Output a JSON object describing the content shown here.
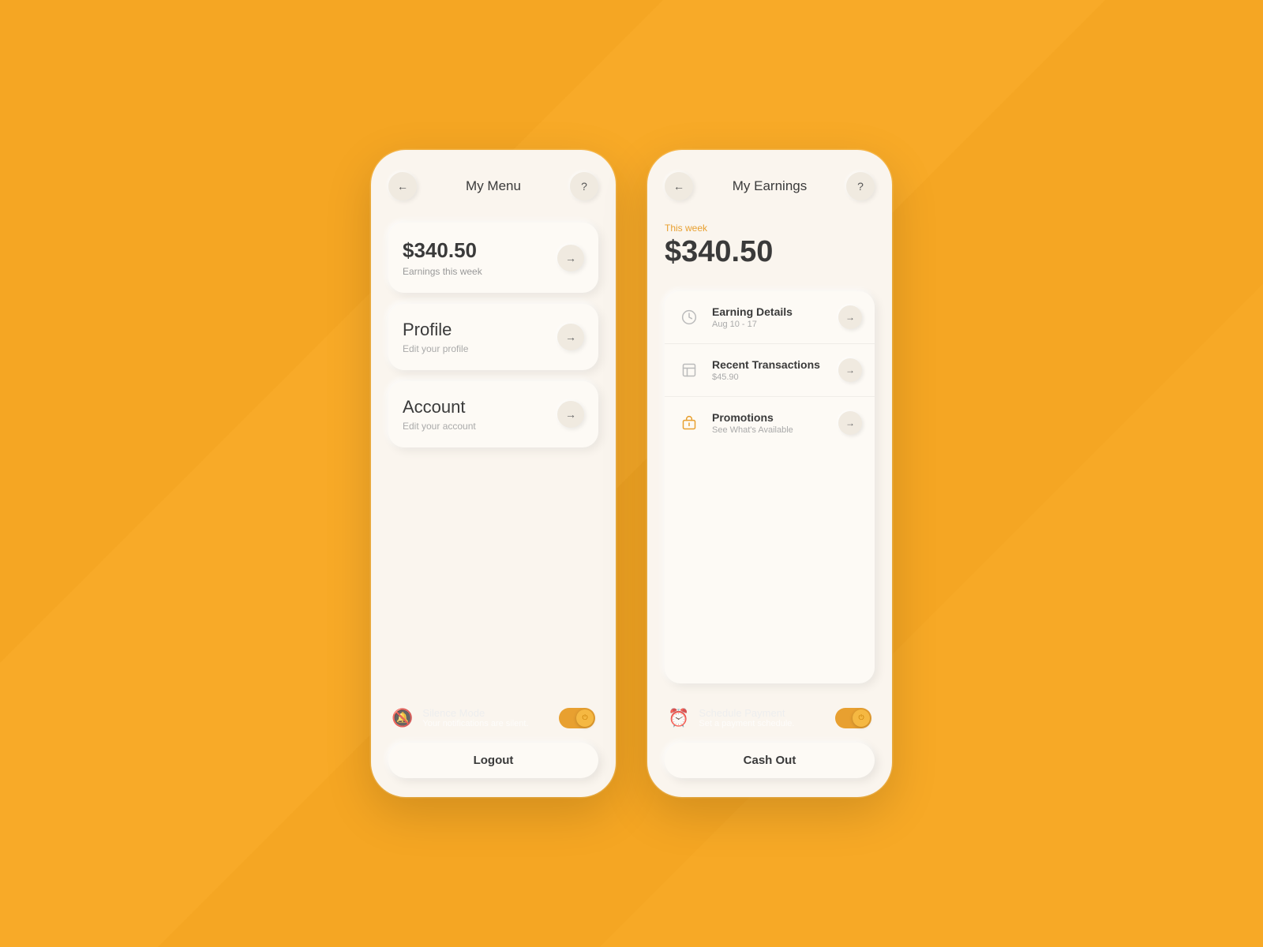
{
  "left_phone": {
    "title": "My Menu",
    "back_label": "←",
    "help_label": "?",
    "earnings_card": {
      "value": "$340.50",
      "subtitle": "Earnings this week"
    },
    "profile_card": {
      "title": "Profile",
      "desc": "Edit your profile"
    },
    "account_card": {
      "title": "Account",
      "desc": "Edit your account"
    },
    "silence_mode": {
      "title": "Silence Mode",
      "desc": "Your notifications are silent.",
      "icon": "🔕"
    },
    "logout_label": "Logout"
  },
  "right_phone": {
    "title": "My Earnings",
    "back_label": "←",
    "help_label": "?",
    "week_label": "This week",
    "earnings_amount": "$340.50",
    "rows": [
      {
        "title": "Earning Details",
        "sub": "Aug 10 - 17",
        "icon": "chart"
      },
      {
        "title": "Recent Transactions",
        "sub": "$45.90",
        "icon": "clock"
      },
      {
        "title": "Promotions",
        "sub": "See What's Available",
        "icon": "gift"
      }
    ],
    "schedule": {
      "title": "Schedule Payment",
      "desc": "Set a payment schedule.",
      "icon": "⏰"
    },
    "cashout_label": "Cash Out"
  }
}
